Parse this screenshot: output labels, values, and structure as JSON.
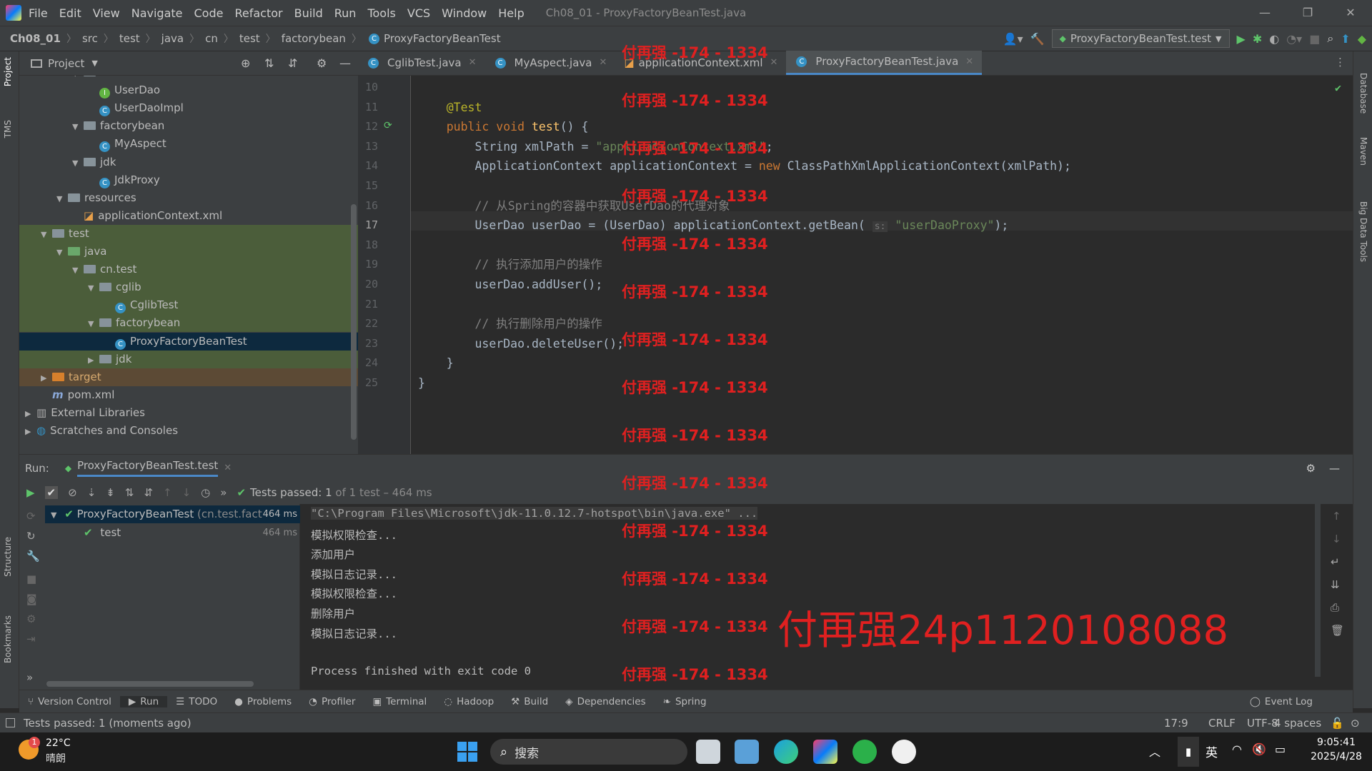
{
  "menubar": {
    "items": [
      "File",
      "Edit",
      "View",
      "Navigate",
      "Code",
      "Refactor",
      "Build",
      "Run",
      "Tools",
      "VCS",
      "Window",
      "Help"
    ],
    "window_title": "Ch08_01 - ProxyFactoryBeanTest.java"
  },
  "breadcrumb": [
    "Ch08_01",
    "src",
    "test",
    "java",
    "cn",
    "test",
    "factorybean",
    "ProxyFactoryBeanTest"
  ],
  "run_config": "ProxyFactoryBeanTest.test",
  "project_panel": {
    "title": "Project",
    "tree": [
      {
        "label": "dao",
        "kind": "folder",
        "depth": 3,
        "open": true
      },
      {
        "label": "UserDao",
        "kind": "interface",
        "depth": 4
      },
      {
        "label": "UserDaoImpl",
        "kind": "class",
        "depth": 4
      },
      {
        "label": "factorybean",
        "kind": "folder",
        "depth": 3,
        "open": true
      },
      {
        "label": "MyAspect",
        "kind": "class",
        "depth": 4
      },
      {
        "label": "jdk",
        "kind": "folder",
        "depth": 3,
        "open": true
      },
      {
        "label": "JdkProxy",
        "kind": "class",
        "depth": 4
      },
      {
        "label": "resources",
        "kind": "folder",
        "depth": 2,
        "open": true
      },
      {
        "label": "applicationContext.xml",
        "kind": "xml",
        "depth": 3
      },
      {
        "label": "test",
        "kind": "folder",
        "depth": 1,
        "open": true
      },
      {
        "label": "java",
        "kind": "folder",
        "depth": 2,
        "open": true
      },
      {
        "label": "cn.test",
        "kind": "folder",
        "depth": 3,
        "open": true
      },
      {
        "label": "cglib",
        "kind": "folder",
        "depth": 4,
        "open": true
      },
      {
        "label": "CglibTest",
        "kind": "class",
        "depth": 5
      },
      {
        "label": "factorybean",
        "kind": "folder",
        "depth": 4,
        "open": true
      },
      {
        "label": "ProxyFactoryBeanTest",
        "kind": "class",
        "depth": 5
      },
      {
        "label": "jdk",
        "kind": "folder",
        "depth": 4,
        "open": false
      },
      {
        "label": "target",
        "kind": "folder",
        "depth": 1,
        "open": false
      },
      {
        "label": "pom.xml",
        "kind": "maven",
        "depth": 1
      },
      {
        "label": "External Libraries",
        "kind": "lib",
        "depth": 0,
        "open": false
      },
      {
        "label": "Scratches and Consoles",
        "kind": "scratch",
        "depth": 0,
        "open": false
      }
    ]
  },
  "editor_tabs": [
    "CglibTest.java",
    "MyAspect.java",
    "applicationContext.xml",
    "ProxyFactoryBeanTest.java"
  ],
  "active_tab": "ProxyFactoryBeanTest.java",
  "code_lines": [
    {
      "n": "10",
      "t": ""
    },
    {
      "n": "11",
      "t": "    @Test"
    },
    {
      "n": "12",
      "t": "    public void test() {"
    },
    {
      "n": "13",
      "t": "        String xmlPath = \"applicationContext.xml\";"
    },
    {
      "n": "14",
      "t": "        ApplicationContext applicationContext = new ClassPathXmlApplicationContext(xmlPath);"
    },
    {
      "n": "15",
      "t": ""
    },
    {
      "n": "16",
      "t": "        // 从Spring的容器中获取UserDao的代理对象"
    },
    {
      "n": "17",
      "t": "        UserDao userDao = (UserDao) applicationContext.getBean( s: \"userDaoProxy\");"
    },
    {
      "n": "18",
      "t": ""
    },
    {
      "n": "19",
      "t": "        // 执行添加用户的操作"
    },
    {
      "n": "20",
      "t": "        userDao.addUser();"
    },
    {
      "n": "21",
      "t": ""
    },
    {
      "n": "22",
      "t": "        // 执行删除用户的操作"
    },
    {
      "n": "23",
      "t": "        userDao.deleteUser();"
    },
    {
      "n": "24",
      "t": "    }"
    },
    {
      "n": "25",
      "t": "}"
    }
  ],
  "run_panel": {
    "label": "Run:",
    "tab": "ProxyFactoryBeanTest.test",
    "status_prefix": "Tests passed:",
    "status_count": "1",
    "status_suffix": "of 1 test – 464 ms",
    "tree": [
      {
        "label": "ProxyFactoryBeanTest",
        "pkg": "(cn.test.fact",
        "time": "464 ms"
      },
      {
        "label": "test",
        "time": "464 ms"
      }
    ],
    "console": [
      "\"C:\\Program Files\\Microsoft\\jdk-11.0.12.7-hotspot\\bin\\java.exe\" ...",
      "模拟权限检查...",
      "添加用户",
      "模拟日志记录...",
      "模拟权限检查...",
      "删除用户",
      "模拟日志记录...",
      "",
      "Process finished with exit code 0"
    ]
  },
  "watermark": {
    "repeat": "付再强 -174 - 1334",
    "big": "付再强24p1120108088"
  },
  "bottom_tabs": [
    "Version Control",
    "Run",
    "TODO",
    "Problems",
    "Profiler",
    "Terminal",
    "Hadoop",
    "Build",
    "Dependencies",
    "Spring"
  ],
  "event_log": "Event Log",
  "statusbar": {
    "message": "Tests passed: 1 (moments ago)",
    "pos": "17:9",
    "eol": "CRLF",
    "enc": "UTF-8",
    "indent": "4 spaces"
  },
  "side_left": [
    "Project",
    "TMS",
    "Structure",
    "Bookmarks"
  ],
  "side_right": [
    "Database",
    "Maven",
    "Big Data Tools"
  ],
  "taskbar": {
    "temp": "22°C",
    "weather": "晴朗",
    "badge": "1",
    "search": "搜索",
    "ime": "英",
    "time": "9:05:41",
    "date": "2025/4/28"
  },
  "colors": {
    "accent": "#4a88c7",
    "pass": "#5ec46a",
    "watermark": "#e02020"
  }
}
